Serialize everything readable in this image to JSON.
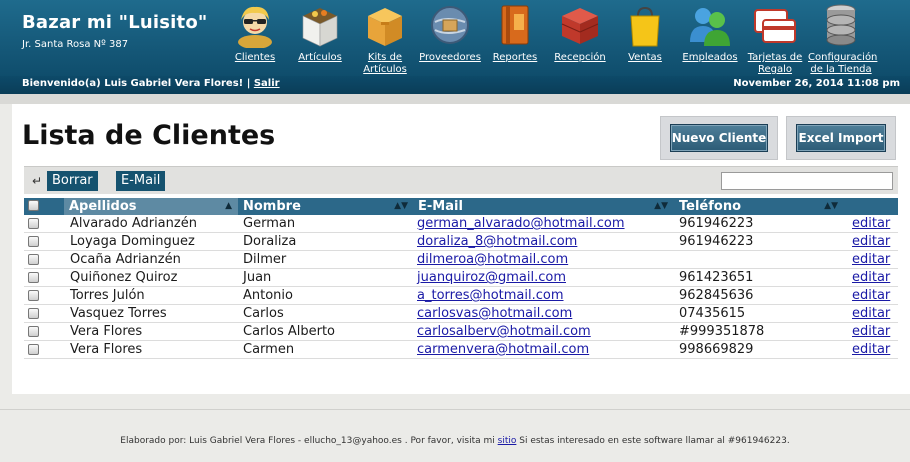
{
  "brand": {
    "title": "Bazar mi \"Luisito\"",
    "address": "Jr. Santa Rosa Nº 387"
  },
  "nav": [
    {
      "label": "Clientes",
      "icon": "customer-icon"
    },
    {
      "label": "Artículos",
      "icon": "box-icon"
    },
    {
      "label": "Kits de Artículos",
      "icon": "kit-box-icon"
    },
    {
      "label": "Proveedores",
      "icon": "supplier-globe-icon"
    },
    {
      "label": "Reportes",
      "icon": "report-book-icon"
    },
    {
      "label": "Recepción",
      "icon": "reception-crate-icon"
    },
    {
      "label": "Ventas",
      "icon": "shopping-bag-icon"
    },
    {
      "label": "Empleados",
      "icon": "employees-icon"
    },
    {
      "label": "Tarjetas de Regalo",
      "icon": "gift-card-icon"
    },
    {
      "label": "Configuración de la Tienda",
      "icon": "database-icon"
    }
  ],
  "subbar": {
    "welcome": "Bienvenido(a) Luis Gabriel Vera Flores! |",
    "logout": "Salir",
    "datetime": "November 26, 2014 11:08 pm"
  },
  "page": {
    "title": "Lista de Clientes"
  },
  "actions": {
    "new_customer": "Nuevo Cliente",
    "excel_import": "Excel Import"
  },
  "toolbar": {
    "delete": "Borrar",
    "email": "E-Mail",
    "search_value": ""
  },
  "table": {
    "columns": [
      "Apellidos",
      "Nombre",
      "E-Mail",
      "Teléfono"
    ],
    "edit_label": "editar",
    "rows": [
      {
        "apellidos": "Alvarado Adrianzén",
        "nombre": "German",
        "email": "german_alvarado@hotmail.com",
        "telefono": "961946223"
      },
      {
        "apellidos": "Loyaga Dominguez",
        "nombre": "Doraliza",
        "email": "doraliza_8@hotmail.com",
        "telefono": "961946223"
      },
      {
        "apellidos": "Ocaña Adrianzén",
        "nombre": "Dilmer",
        "email": "dilmeroa@hotmail.com",
        "telefono": ""
      },
      {
        "apellidos": "Quiñonez Quiroz",
        "nombre": "Juan",
        "email": "juanquiroz@gmail.com",
        "telefono": "961423651"
      },
      {
        "apellidos": "Torres Julón",
        "nombre": "Antonio",
        "email": "a_torres@hotmail.com",
        "telefono": "962845636"
      },
      {
        "apellidos": "Vasquez Torres",
        "nombre": "Carlos",
        "email": "carlosvas@hotmail.com",
        "telefono": "07435615"
      },
      {
        "apellidos": "Vera Flores",
        "nombre": "Carlos Alberto",
        "email": "carlosalberv@hotmail.com",
        "telefono": "#999351878"
      },
      {
        "apellidos": "Vera Flores",
        "nombre": "Carmen",
        "email": "carmenvera@hotmail.com",
        "telefono": "998669829"
      }
    ]
  },
  "footer": {
    "before": "Elaborado por: Luis Gabriel Vera Flores - ellucho_13@yahoo.es . Por favor, visita mi",
    "link": "sitio",
    "after": "Si estas interesado en este software llamar al #961946223."
  },
  "colors": {
    "header": "#1f6b8d",
    "accent": "#2c6889",
    "link": "#1a1aa6"
  }
}
